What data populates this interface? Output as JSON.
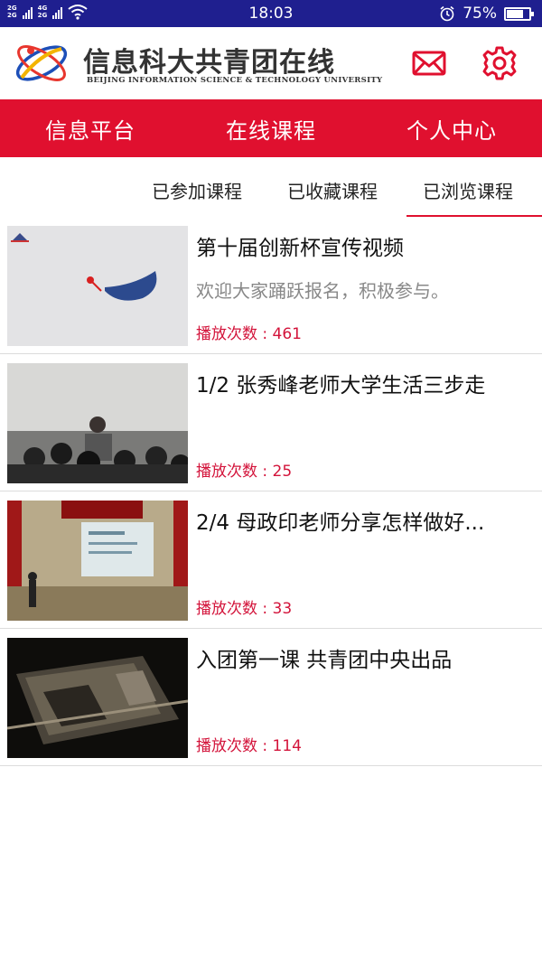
{
  "status_bar": {
    "net_top": "2G",
    "net_mid": "4G",
    "net_bottom": "2G",
    "time": "18:03",
    "battery": "75%",
    "icons": [
      "signal-icon",
      "wifi-icon",
      "alarm-icon",
      "battery-icon"
    ]
  },
  "header": {
    "title": "信息科大共青团在线",
    "subtitle": "BEIJING INFORMATION SCIENCE & TECHNOLOGY UNIVERSITY",
    "icons": [
      "mail-icon",
      "gear-icon"
    ]
  },
  "tabs": [
    {
      "label": "信息平台"
    },
    {
      "label": "在线课程"
    },
    {
      "label": "个人中心"
    }
  ],
  "subtabs": [
    {
      "label": "已参加课程"
    },
    {
      "label": "已收藏课程"
    },
    {
      "label": "已浏览课程"
    }
  ],
  "courses": [
    {
      "title": "第十届创新杯宣传视频",
      "desc": "欢迎大家踊跃报名，积极参与。",
      "plays": "播放次数 : 461"
    },
    {
      "title": "1/2 张秀峰老师大学生活三步走",
      "desc": "",
      "plays": "播放次数 : 25"
    },
    {
      "title": "2/4 母政印老师分享怎样做好...",
      "desc": "",
      "plays": "播放次数 : 33"
    },
    {
      "title": "入团第一课 共青团中央出品",
      "desc": "",
      "plays": "播放次数 : 114"
    }
  ],
  "colors": {
    "status_bar": "#1f1f8f",
    "accent_red": "#e0102f",
    "plays_text": "#d3133a"
  }
}
